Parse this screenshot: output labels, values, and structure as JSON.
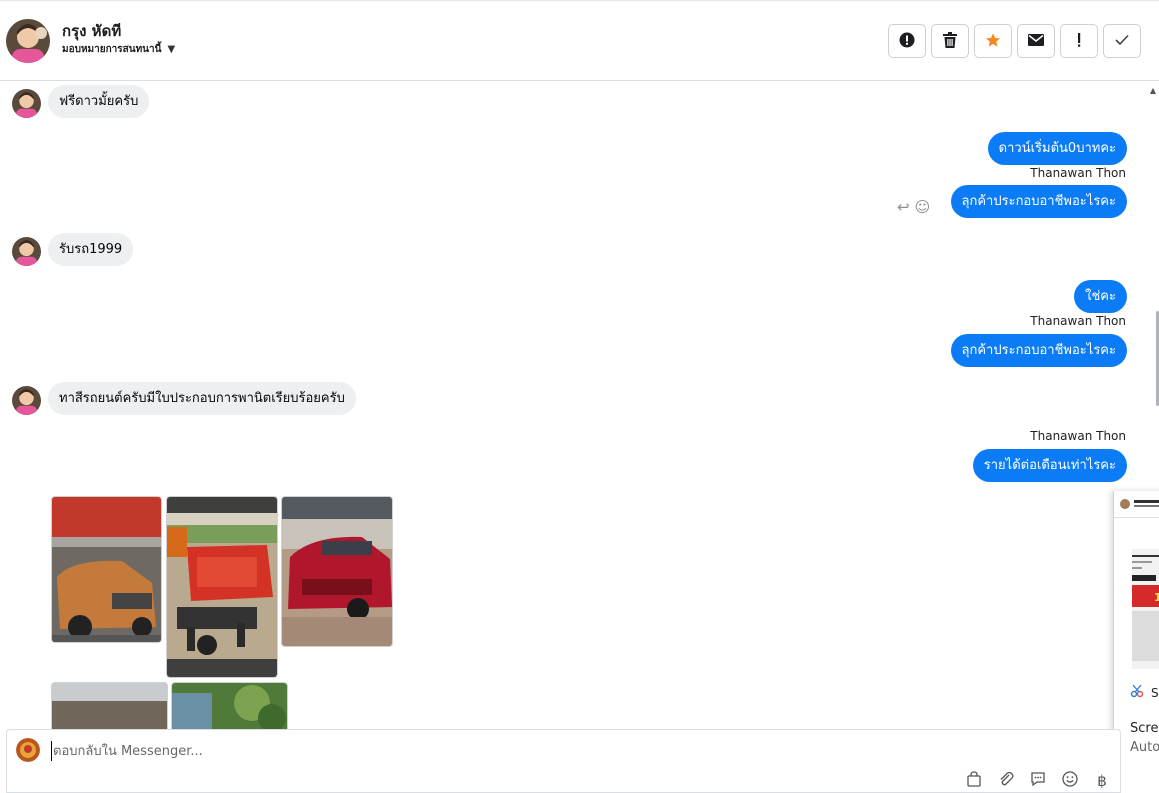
{
  "contact": {
    "name": "กรุง หัดที",
    "assign_label": "มอบหมายการสนทนานี้"
  },
  "toolbar": {
    "buttons": [
      {
        "icon": "alert-circle-icon",
        "glyph": "!"
      },
      {
        "icon": "trash-icon",
        "glyph": "🗑"
      },
      {
        "icon": "star-icon",
        "glyph": "★"
      },
      {
        "icon": "envelope-icon",
        "glyph": "✉"
      },
      {
        "icon": "exclamation-icon",
        "glyph": "!"
      },
      {
        "icon": "check-icon",
        "glyph": "✓"
      }
    ]
  },
  "messages": {
    "m1": "ฟรีดาวมั้ยครับ",
    "m2": "ดาวน์เริ่มต้น0บาทคะ",
    "m3_sender": "Thanawan Thon",
    "m3": "ลุกค้าประกอบอาชีพอะไรคะ",
    "m4": "รับรถ1999",
    "m5": "ใช่คะ",
    "m6_sender": "Thanawan Thon",
    "m6": "ลุกค้าประกอบอาชีพอะไรคะ",
    "m7": "ทาสีรถยนต์ครับมีใบประกอบการพานิตเรียบร้อยครับ",
    "m8_sender": "Thanawan Thon",
    "m8": "รายได้ต่อเดือนเท่าไรคะ"
  },
  "reactions": {
    "reply_glyph": "↩",
    "emoji_glyph": "☺"
  },
  "popup": {
    "tool_label": "S",
    "title": "Scree",
    "subtitle": "Auto"
  },
  "composer": {
    "placeholder": "ตอบกลับใน Messenger...",
    "currency_glyph": "฿"
  },
  "colors": {
    "outgoing_bubble": "#0b7cf5",
    "incoming_bubble": "#eeeff1",
    "star": "#f5871f"
  }
}
